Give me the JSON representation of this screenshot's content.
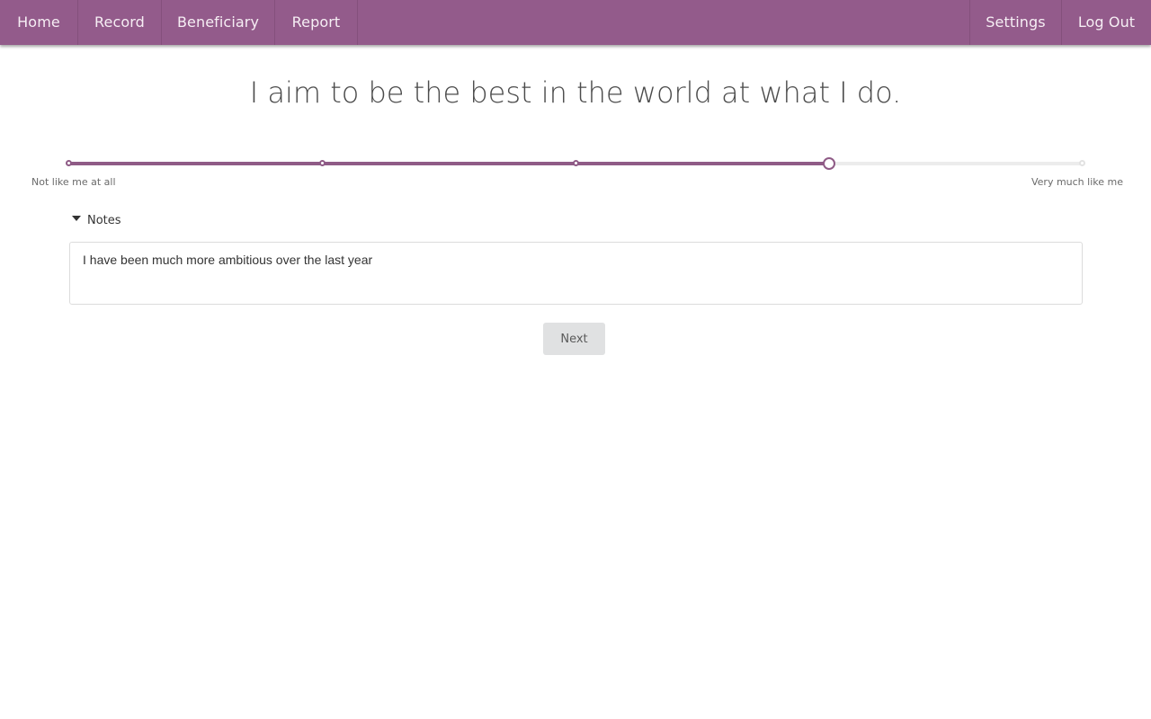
{
  "nav": {
    "left_items": [
      "Home",
      "Record",
      "Beneficiary",
      "Report"
    ],
    "right_items": [
      "Settings",
      "Log Out"
    ]
  },
  "question": "I aim to be the best in the world at what I do.",
  "scale": {
    "min_label": "Not like me at all",
    "max_label": "Very much like me",
    "steps": 5,
    "selected": 4
  },
  "notes": {
    "toggle_label": "Notes",
    "value": "I have been much more ambitious over the last year"
  },
  "next_button": "Next",
  "colors": {
    "nav_bg": "#935b8b",
    "accent": "#8f5b86",
    "button_bg": "#e0e1e2"
  }
}
